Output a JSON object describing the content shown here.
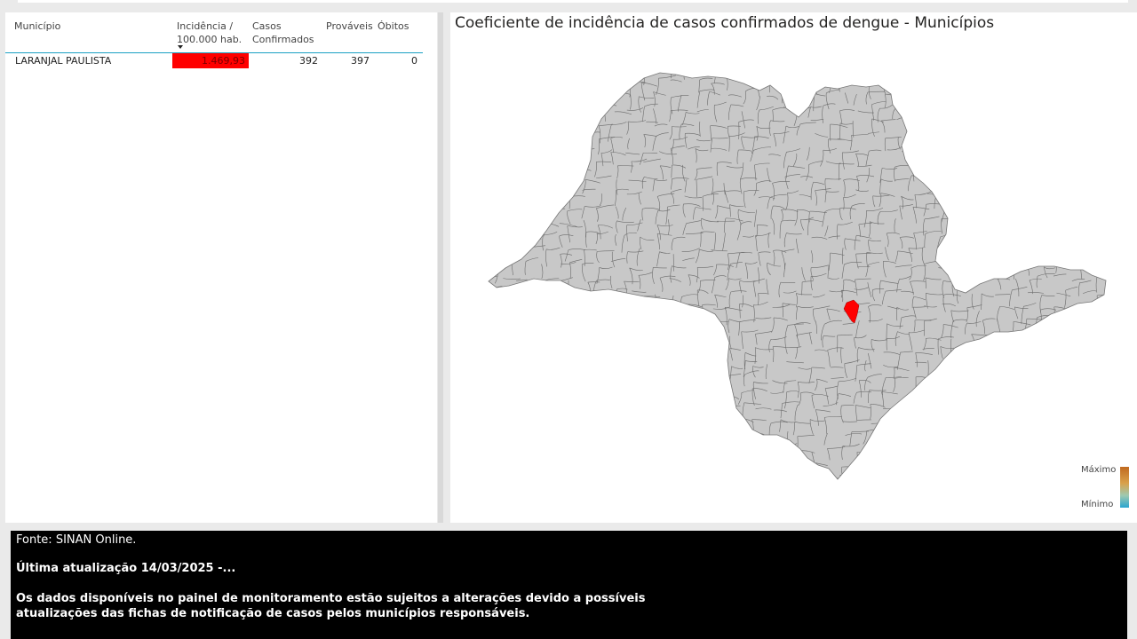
{
  "table": {
    "headers": {
      "municipio": "Município",
      "incidencia": "Incidência / 100.000 hab.",
      "casos": "Casos Confirmados",
      "provaveis": "Prováveis",
      "obitos": "Óbitos"
    },
    "rows": [
      {
        "municipio": "LARANJAL PAULISTA",
        "incidencia": "1.469,93",
        "casos": "392",
        "provaveis": "397",
        "obitos": "0"
      }
    ],
    "highlight_color": "#ff0000"
  },
  "map": {
    "title": "Coeficiente de incidência de casos confirmados de dengue - Municípios",
    "base_color": "#c8c8c8",
    "highlight_color": "#ff0000",
    "legend": {
      "max_label": "Máximo",
      "min_label": "Mínimo"
    }
  },
  "footer": {
    "source": "Fonte: SINAN Online.",
    "update": "Última atualização 14/03/2025 -...",
    "note": "Os dados disponíveis no painel de monitoramento estão sujeitos a alterações devido a possíveis atualizações das fichas de notificação de casos pelos municípios responsáveis."
  }
}
